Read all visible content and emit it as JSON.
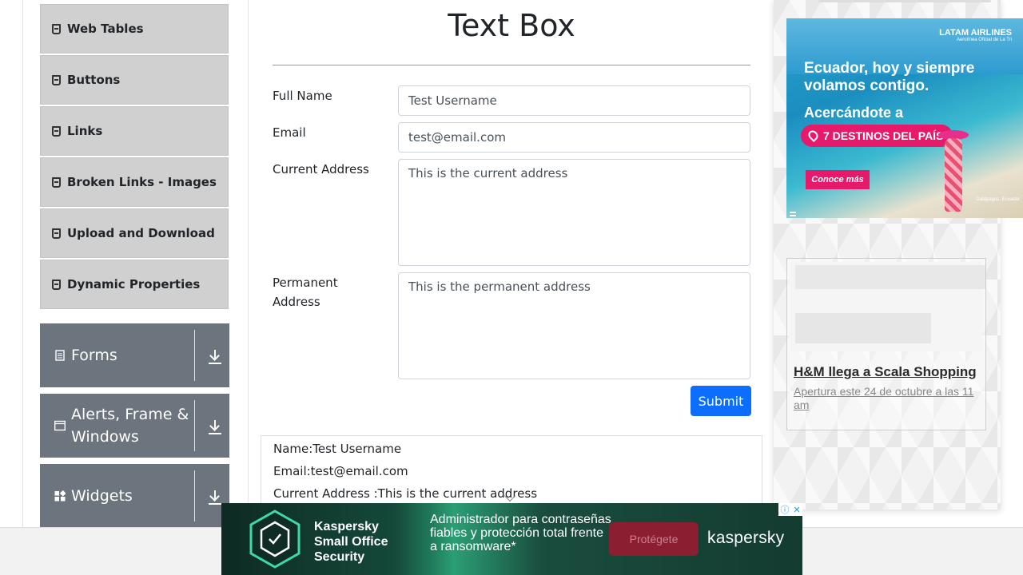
{
  "sidebar": {
    "items": [
      {
        "label": "Web Tables"
      },
      {
        "label": "Buttons"
      },
      {
        "label": "Links"
      },
      {
        "label": "Broken Links - Images"
      },
      {
        "label": "Upload and Download"
      },
      {
        "label": "Dynamic Properties"
      }
    ],
    "groups": [
      {
        "label": "Forms",
        "icon": "form-icon"
      },
      {
        "label": "Alerts, Frame & Windows",
        "icon": "window-icon"
      },
      {
        "label": "Widgets",
        "icon": "widgets-icon"
      }
    ]
  },
  "form": {
    "title": "Text Box",
    "full_name_label": "Full Name",
    "full_name_value": "Test Username",
    "email_label": "Email",
    "email_value": "test@email.com",
    "current_address_label": "Current Address",
    "current_address_value": "This is the current address",
    "permanent_address_label": "Permanent Address",
    "permanent_address_value": "This is the permanent address",
    "submit_label": "Submit"
  },
  "output": {
    "name_line": "Name:Test Username",
    "email_line": "Email:test@email.com",
    "current_address_line": "Current Address :This is the current address"
  },
  "ads": {
    "latam": {
      "brand": "LATAM AIRLINES",
      "brand_sub": "Aerolínea Oficial de La Tri",
      "headline": "Ecuador, hoy y siempre volamos contigo.",
      "sub_headline": "Acercándote a",
      "pill": "7 DESTINOS DEL PAÍS",
      "cta": "Conoce más",
      "place": "Galápagos, Ecuador"
    },
    "hm": {
      "headline": "H&M llega a Scala Shopping",
      "sub": "Apertura este 24 de octubre a las 11 am"
    },
    "kaspersky": {
      "product": "Kaspersky Small Office Security",
      "tagline": "Administrador para contraseñas fiables y protección total frente a ransomware*",
      "button": "Protégete",
      "brand": "kaspersky"
    }
  },
  "colors": {
    "primary_button": "#0d6efd",
    "sidebar_item_bg": "#d0d0d0",
    "group_bg": "#6c757d",
    "ad_pink": "#e6196a"
  }
}
